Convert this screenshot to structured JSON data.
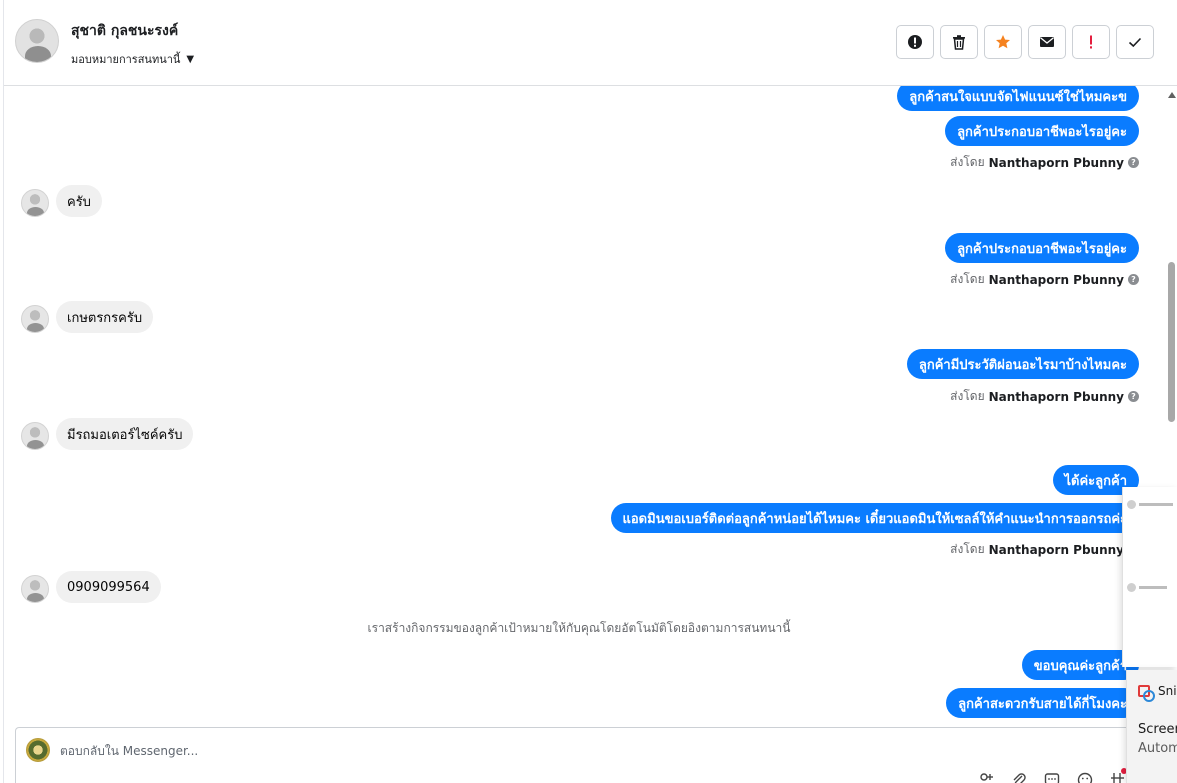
{
  "header": {
    "contact_name": "สุชาติ กุลชนะรงค์",
    "assign_label": "มอบหมายการสนทนานี้"
  },
  "actions": [
    {
      "name": "spam",
      "icon": "alert-circle-icon"
    },
    {
      "name": "delete",
      "icon": "trash-icon"
    },
    {
      "name": "star",
      "icon": "star-icon",
      "color": "#f5821f"
    },
    {
      "name": "mark-unread",
      "icon": "envelope-icon"
    },
    {
      "name": "follow-up",
      "icon": "exclamation-icon",
      "color": "#e41e3f"
    },
    {
      "name": "done",
      "icon": "check-icon"
    }
  ],
  "messages": {
    "m1": "ลูกค้าสนใจแบบจัดไฟแนนซ์ใช่ไหมคะข",
    "m2": "ลูกค้าประกอบอาชีพอะไรอยู่คะ",
    "m3": "ครับ",
    "m4": "ลูกค้าประกอบอาชีพอะไรอยู่คะ",
    "m5": "เกษตรกรครับ",
    "m6": "ลูกค้ามีประวัติผ่อนอะไรมาบ้างไหมคะ",
    "m7": "มีรถมอเตอร์ไซค์ครับ",
    "m8": "ได้ค่ะลูกค้า",
    "m9": "แอดมินขอเบอร์ติดต่อลูกค้าหน่อยได้ไหมคะ เดี๋ยวแอดมินให้เซลล์ให้คำแนะนำการออกรถค่ะ",
    "m10": "0909099564",
    "m11": "ขอบคุณค่ะลูกค้า",
    "m12": "ลูกค้าสะดวกรับสายได้กี่โมงคะ"
  },
  "sent_by": {
    "prefix": "ส่งโดย",
    "agent": "Nanthaporn Pbunny"
  },
  "system_note": "เราสร้างกิจกรรมของลูกค้าเป้าหมายให้กับคุณโดยอัตโนมัติโดยอิงตามการสนทนานี้",
  "composer": {
    "placeholder": "ตอบกลับใน Messenger..."
  },
  "snip_toast": {
    "title": "Sni",
    "line1": "Screen",
    "line2": "Autom"
  },
  "colors": {
    "outgoing_bubble": "#0a7cff",
    "incoming_bubble": "#f0f0f0"
  }
}
